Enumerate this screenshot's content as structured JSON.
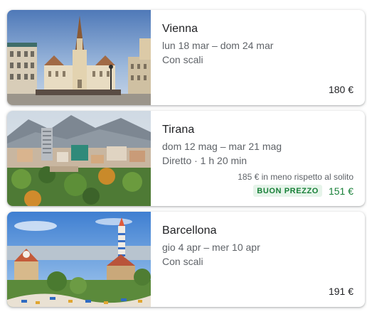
{
  "destinations": [
    {
      "city": "Vienna",
      "dates": "lun 18 mar – dom 24 mar",
      "stops": "Con scali",
      "price": "180 €",
      "image": "vienna-church-square-photo"
    },
    {
      "city": "Tirana",
      "dates": "dom 12 mag – mar 21 mag",
      "stops": "Diretto · 1 h 20 min",
      "saving_note": "185 € in meno rispetto al solito",
      "badge": "BUON PREZZO",
      "price": "151 €",
      "image": "tirana-city-mountains-photo"
    },
    {
      "city": "Barcellona",
      "dates": "gio 4 apr – mer 10 apr",
      "stops": "Con scali",
      "price": "191 €",
      "image": "barcelona-park-guell-photo"
    }
  ],
  "colors": {
    "primary_text": "#202124",
    "secondary_text": "#5f6368",
    "deal_green": "#188038",
    "badge_background": "#e6f4ea"
  }
}
